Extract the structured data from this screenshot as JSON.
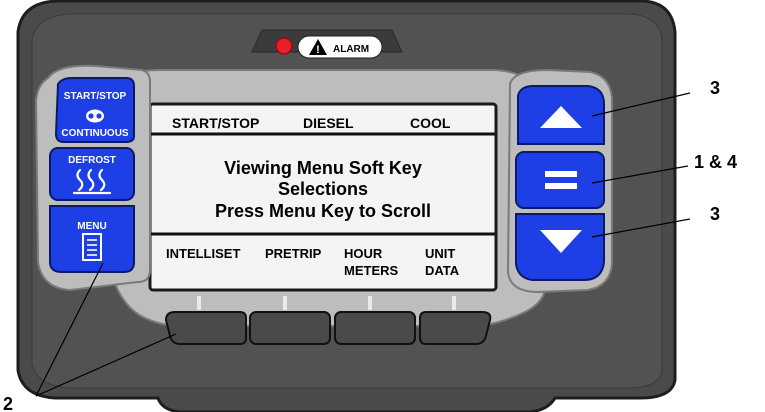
{
  "alarm": {
    "label": "ALARM"
  },
  "left_buttons": {
    "start_stop": {
      "line1": "START/STOP",
      "line2": "CONTINUOUS"
    },
    "defrost": {
      "label": "DEFROST"
    },
    "menu": {
      "label": "MENU"
    }
  },
  "display": {
    "status": {
      "mode": "START/STOP",
      "fuel": "DIESEL",
      "state": "COOL"
    },
    "message": {
      "line1": "Viewing Menu Soft Key",
      "line2": "Selections",
      "line3": "Press Menu Key to Scroll"
    },
    "soft_keys": [
      {
        "line1": "INTELLISET",
        "line2": ""
      },
      {
        "line1": "PRETRIP",
        "line2": ""
      },
      {
        "line1": "HOUR",
        "line2": "METERS"
      },
      {
        "line1": "UNIT",
        "line2": "DATA"
      }
    ]
  },
  "callouts": {
    "up": "3",
    "select": "1 & 4",
    "down": "3",
    "soft_keys": "2"
  },
  "colors": {
    "button_blue": "#1f3fe6",
    "housing_dark": "#4a4a4a",
    "bezel_light": "#bdbdbd",
    "alarm_led": "#e8202a"
  }
}
